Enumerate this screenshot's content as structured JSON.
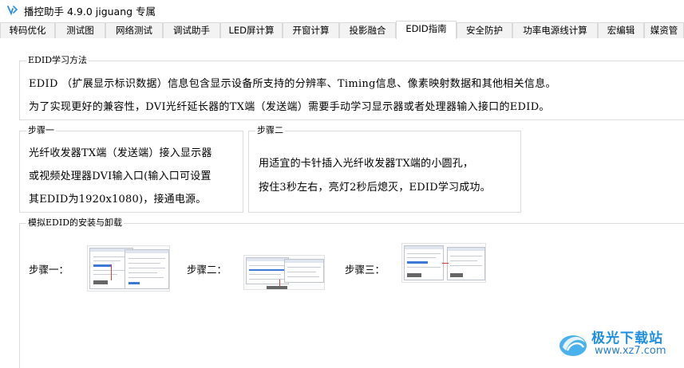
{
  "app": {
    "icon": "app-logo-icon",
    "title": "播控助手 4.9.0  jiguang 专属"
  },
  "tabs": [
    {
      "label": "转码优化",
      "active": false
    },
    {
      "label": "测试图",
      "active": false
    },
    {
      "label": "网络测试",
      "active": false
    },
    {
      "label": "调试助手",
      "active": false
    },
    {
      "label": "LED屏计算",
      "active": false
    },
    {
      "label": "开窗计算",
      "active": false
    },
    {
      "label": "投影融合",
      "active": false
    },
    {
      "label": "EDID指南",
      "active": true
    },
    {
      "label": "安全防护",
      "active": false
    },
    {
      "label": "功率电源线计算",
      "active": false
    },
    {
      "label": "宏编辑",
      "active": false
    },
    {
      "label": "媒资管",
      "active": false
    }
  ],
  "edid_section": {
    "legend": "EDID学习方法",
    "lines": [
      "EDID （扩展显示标识数据）信息包含显示设备所支持的分辨率、Timing信息、像素映射数据和其他相关信息。",
      "为了实现更好的兼容性，DVI光纤延长器的TX端（发送端）需要手动学习显示器或者处理器输入接口的EDID。"
    ]
  },
  "step1": {
    "legend": "步骤一",
    "lines": [
      "光纤收发器TX端（发送端）接入显示器",
      "或视频处理器DVI输入口(输入口可设置",
      "其EDID为1920x1080)，接通电源。"
    ]
  },
  "step2": {
    "legend": "步骤二",
    "lines": [
      "用适宜的卡针插入光纤收发器TX端的小圆孔，",
      "按住3秒左右，亮灯2秒后熄灭，EDID学习成功。"
    ]
  },
  "simulate": {
    "legend": "模拟EDID的安装与卸载",
    "steps": [
      {
        "label": "步骤一：",
        "thumbnail": "step1-screenshot-thumbnail"
      },
      {
        "label": "步骤二：",
        "thumbnail": "step2-screenshot-thumbnail"
      },
      {
        "label": "步骤三：",
        "thumbnail": "step3-screenshot-thumbnail"
      }
    ]
  },
  "watermark": {
    "title": "极光下载站",
    "url": "www.xz7.com",
    "icon": "aurora-logo-icon"
  },
  "colors": {
    "tab_border": "#d9d9d9",
    "group_border": "#dcdcdc",
    "watermark_blue": "#1f8fe0"
  }
}
